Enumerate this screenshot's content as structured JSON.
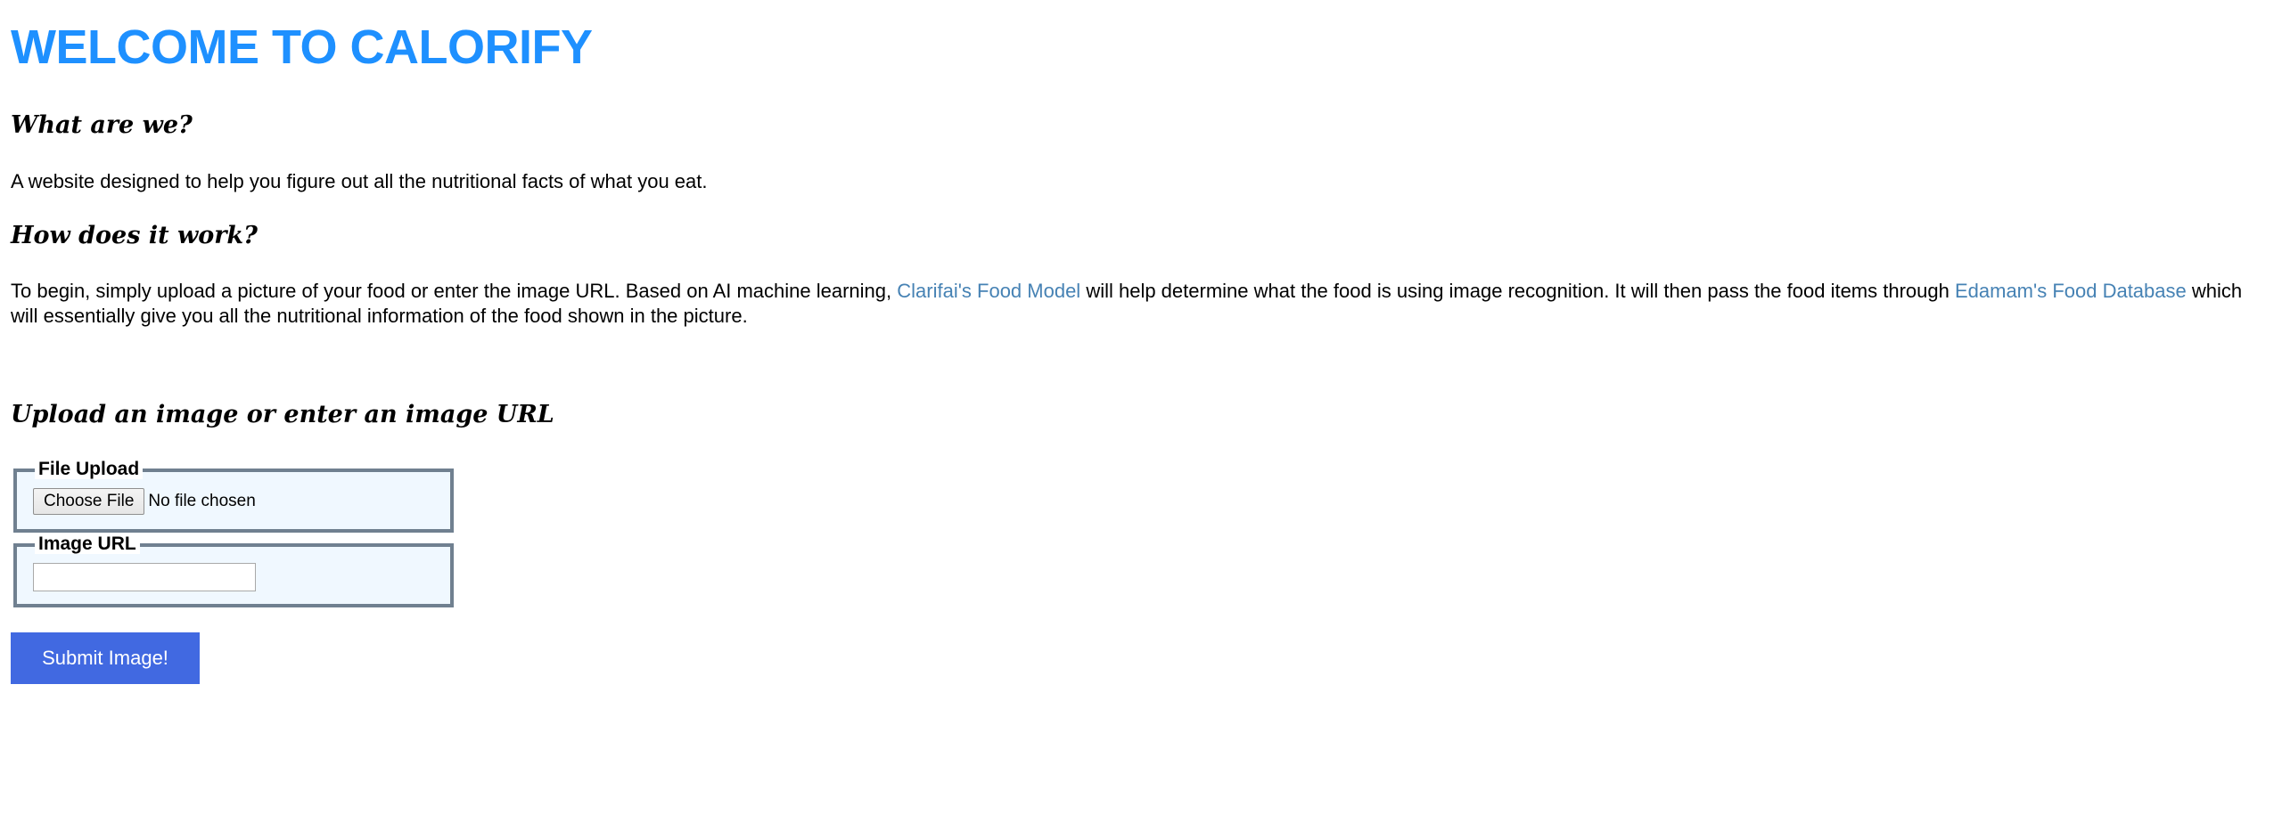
{
  "header": {
    "title": "WELCOME TO CALORIFY"
  },
  "about": {
    "heading": "What are we?",
    "text": "A website designed to help you figure out all the nutritional facts of what you eat."
  },
  "how": {
    "heading": "How does it work?",
    "text_part1": "To begin, simply upload a picture of your food or enter the image URL. Based on AI machine learning, ",
    "link1": "Clarifai's Food Model",
    "text_part2": " will help determine what the food is using image recognition. It will then pass the food items through ",
    "link2": "Edamam's Food Database",
    "text_part3": " which will essentially give you all the nutritional information of the food shown in the picture."
  },
  "upload": {
    "heading": "Upload an image or enter an image URL",
    "file_legend": "File Upload",
    "choose_file_label": "Choose File",
    "file_status": "No file chosen",
    "url_legend": "Image URL",
    "url_value": "",
    "submit_label": "Submit Image!"
  },
  "colors": {
    "title": "#1e90ff",
    "link": "#4682b4",
    "fieldset_border": "#708090",
    "fieldset_bg": "#f0f8ff",
    "submit_bg": "#4169e1"
  }
}
